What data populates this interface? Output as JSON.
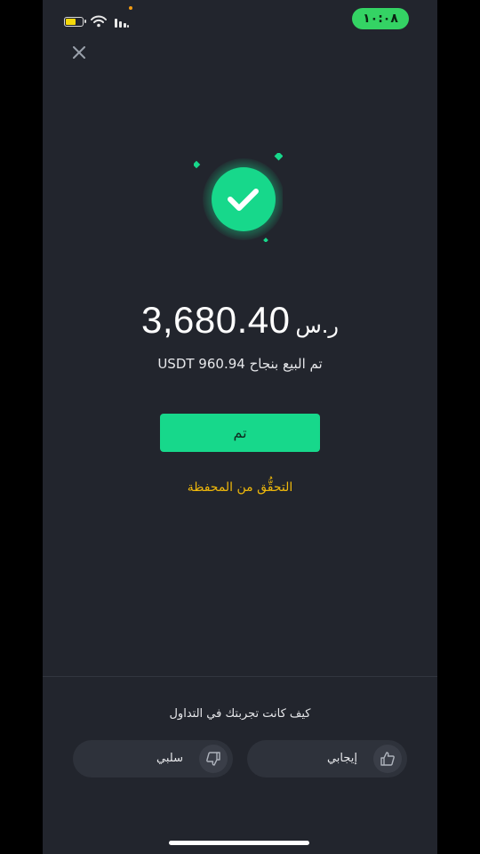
{
  "status_bar": {
    "time": "١٠:٠٨",
    "battery_level": 0.65
  },
  "amount": {
    "value": "3,680.40",
    "currency": "ر.س"
  },
  "subtitle": "تم البيع بنجاح USDT 960.94",
  "done_button": "تم",
  "wallet_link": "التحقُّق من المحفظة",
  "feedback": {
    "question": "كيف كانت تجربتك في التداول",
    "positive_label": "إيجابي",
    "negative_label": "سلبي"
  },
  "colors": {
    "background": "#22252d",
    "accent": "#17d88b",
    "link": "#f0b90b",
    "status_time_bg": "#34d364"
  },
  "icons": {
    "close": "close-icon",
    "success": "check-circle-icon",
    "positive": "thumbs-up-icon",
    "negative": "thumbs-down-icon"
  }
}
